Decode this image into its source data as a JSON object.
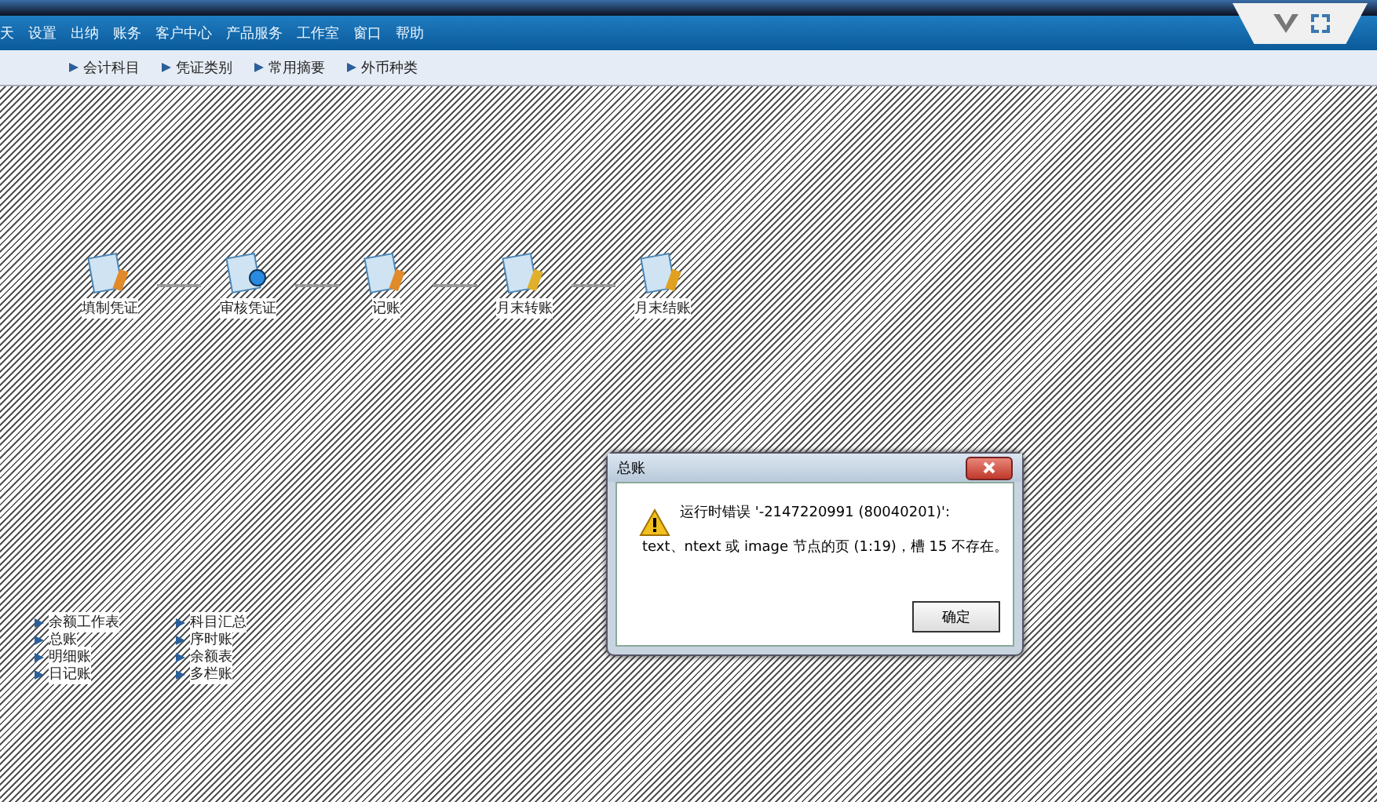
{
  "menu_bar": {
    "items": [
      "天",
      "设置",
      "出纳",
      "账务",
      "客户中心",
      "产品服务",
      "工作室",
      "窗口",
      "帮助"
    ]
  },
  "toolbar": {
    "items": [
      "会计科目",
      "凭证类别",
      "常用摘要",
      "外币种类"
    ]
  },
  "flow": {
    "steps": [
      {
        "label": "填制凭证",
        "kind": "edit"
      },
      {
        "label": "审核凭证",
        "kind": "review"
      },
      {
        "label": "记账",
        "kind": "book"
      },
      {
        "label": "月末转账",
        "kind": "transfer"
      },
      {
        "label": "月末结账",
        "kind": "close"
      }
    ]
  },
  "links": {
    "column_1": [
      "余额工作表",
      "总账",
      "明细账",
      "日记账"
    ],
    "column_2": [
      "科目汇总",
      "序时账",
      "余额表",
      "多栏账"
    ]
  },
  "dialog": {
    "title": "总账",
    "message": "运行时错误 '-2147220991 (80040201)':",
    "detail": "text、ntext 或 image 节点的页 (1:19)，槽 15 不存在。",
    "button": "确定"
  }
}
